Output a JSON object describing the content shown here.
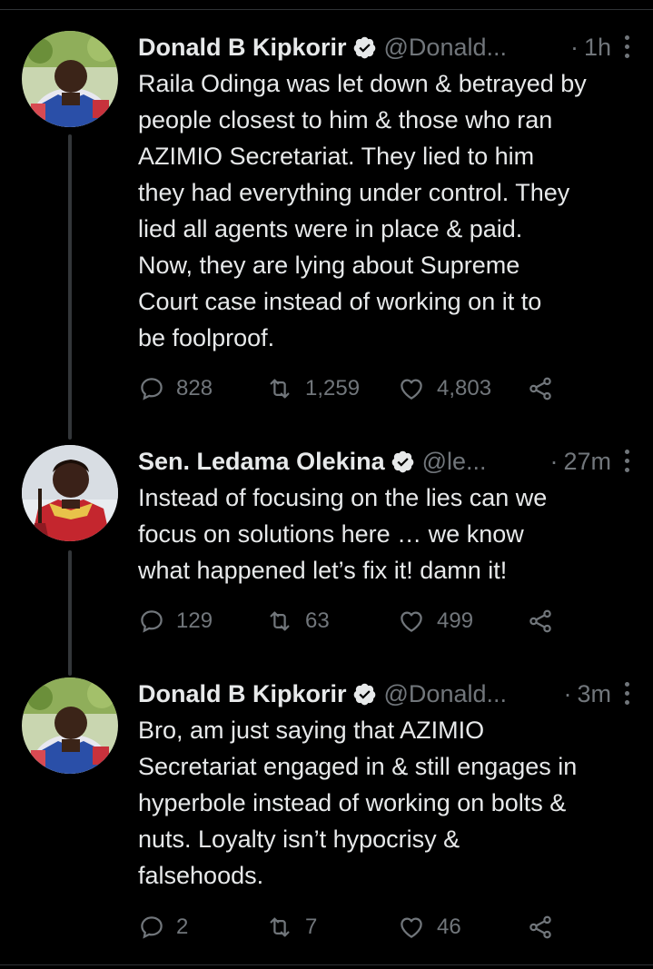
{
  "tweets": [
    {
      "name": "Donald B Kipkorir",
      "handle": "@Donald...",
      "time": "1h",
      "text": "Raila Odinga was let down & betrayed by people closest to him & those who ran AZIMIO Secretariat. They lied to him they had everything under control. They lied all agents were in place & paid. Now, they are lying about Supreme Court case instead of working on it to be foolproof.",
      "lines": [
        "Raila Odinga was let down & betrayed by",
        "people closest to him & those who ran",
        "AZIMIO Secretariat. They lied to him",
        "they had everything under control. They",
        "lied all agents were in place & paid.",
        "Now, they are lying about Supreme",
        "Court case instead of working on it to",
        "be foolproof."
      ],
      "replies": "828",
      "retweets": "1,259",
      "likes": "4,803"
    },
    {
      "name": "Sen. Ledama Olekina",
      "handle": "@le...",
      "time": "27m",
      "lines": [
        "Instead of focusing on the lies can we",
        "focus on solutions here … we know",
        "what happened let’s fix it! damn it!"
      ],
      "replies": "129",
      "retweets": "63",
      "likes": "499"
    },
    {
      "name": "Donald B Kipkorir",
      "handle": "@Donald...",
      "time": "3m",
      "lines": [
        "Bro, am just saying that AZIMIO",
        "Secretariat engaged in & still engages in",
        "hyperbole instead of working on bolts &",
        "nuts. Loyalty isn’t hypocrisy &",
        "falsehoods."
      ],
      "replies": "2",
      "retweets": "7",
      "likes": "46"
    }
  ],
  "separator": "·",
  "colors": {
    "background": "#000000",
    "text": "#e7e9ea",
    "muted": "#71767b",
    "verified": "#e7e9ea"
  },
  "icons": [
    "verified-badge-icon",
    "more-icon",
    "reply-icon",
    "retweet-icon",
    "like-icon",
    "share-icon"
  ]
}
